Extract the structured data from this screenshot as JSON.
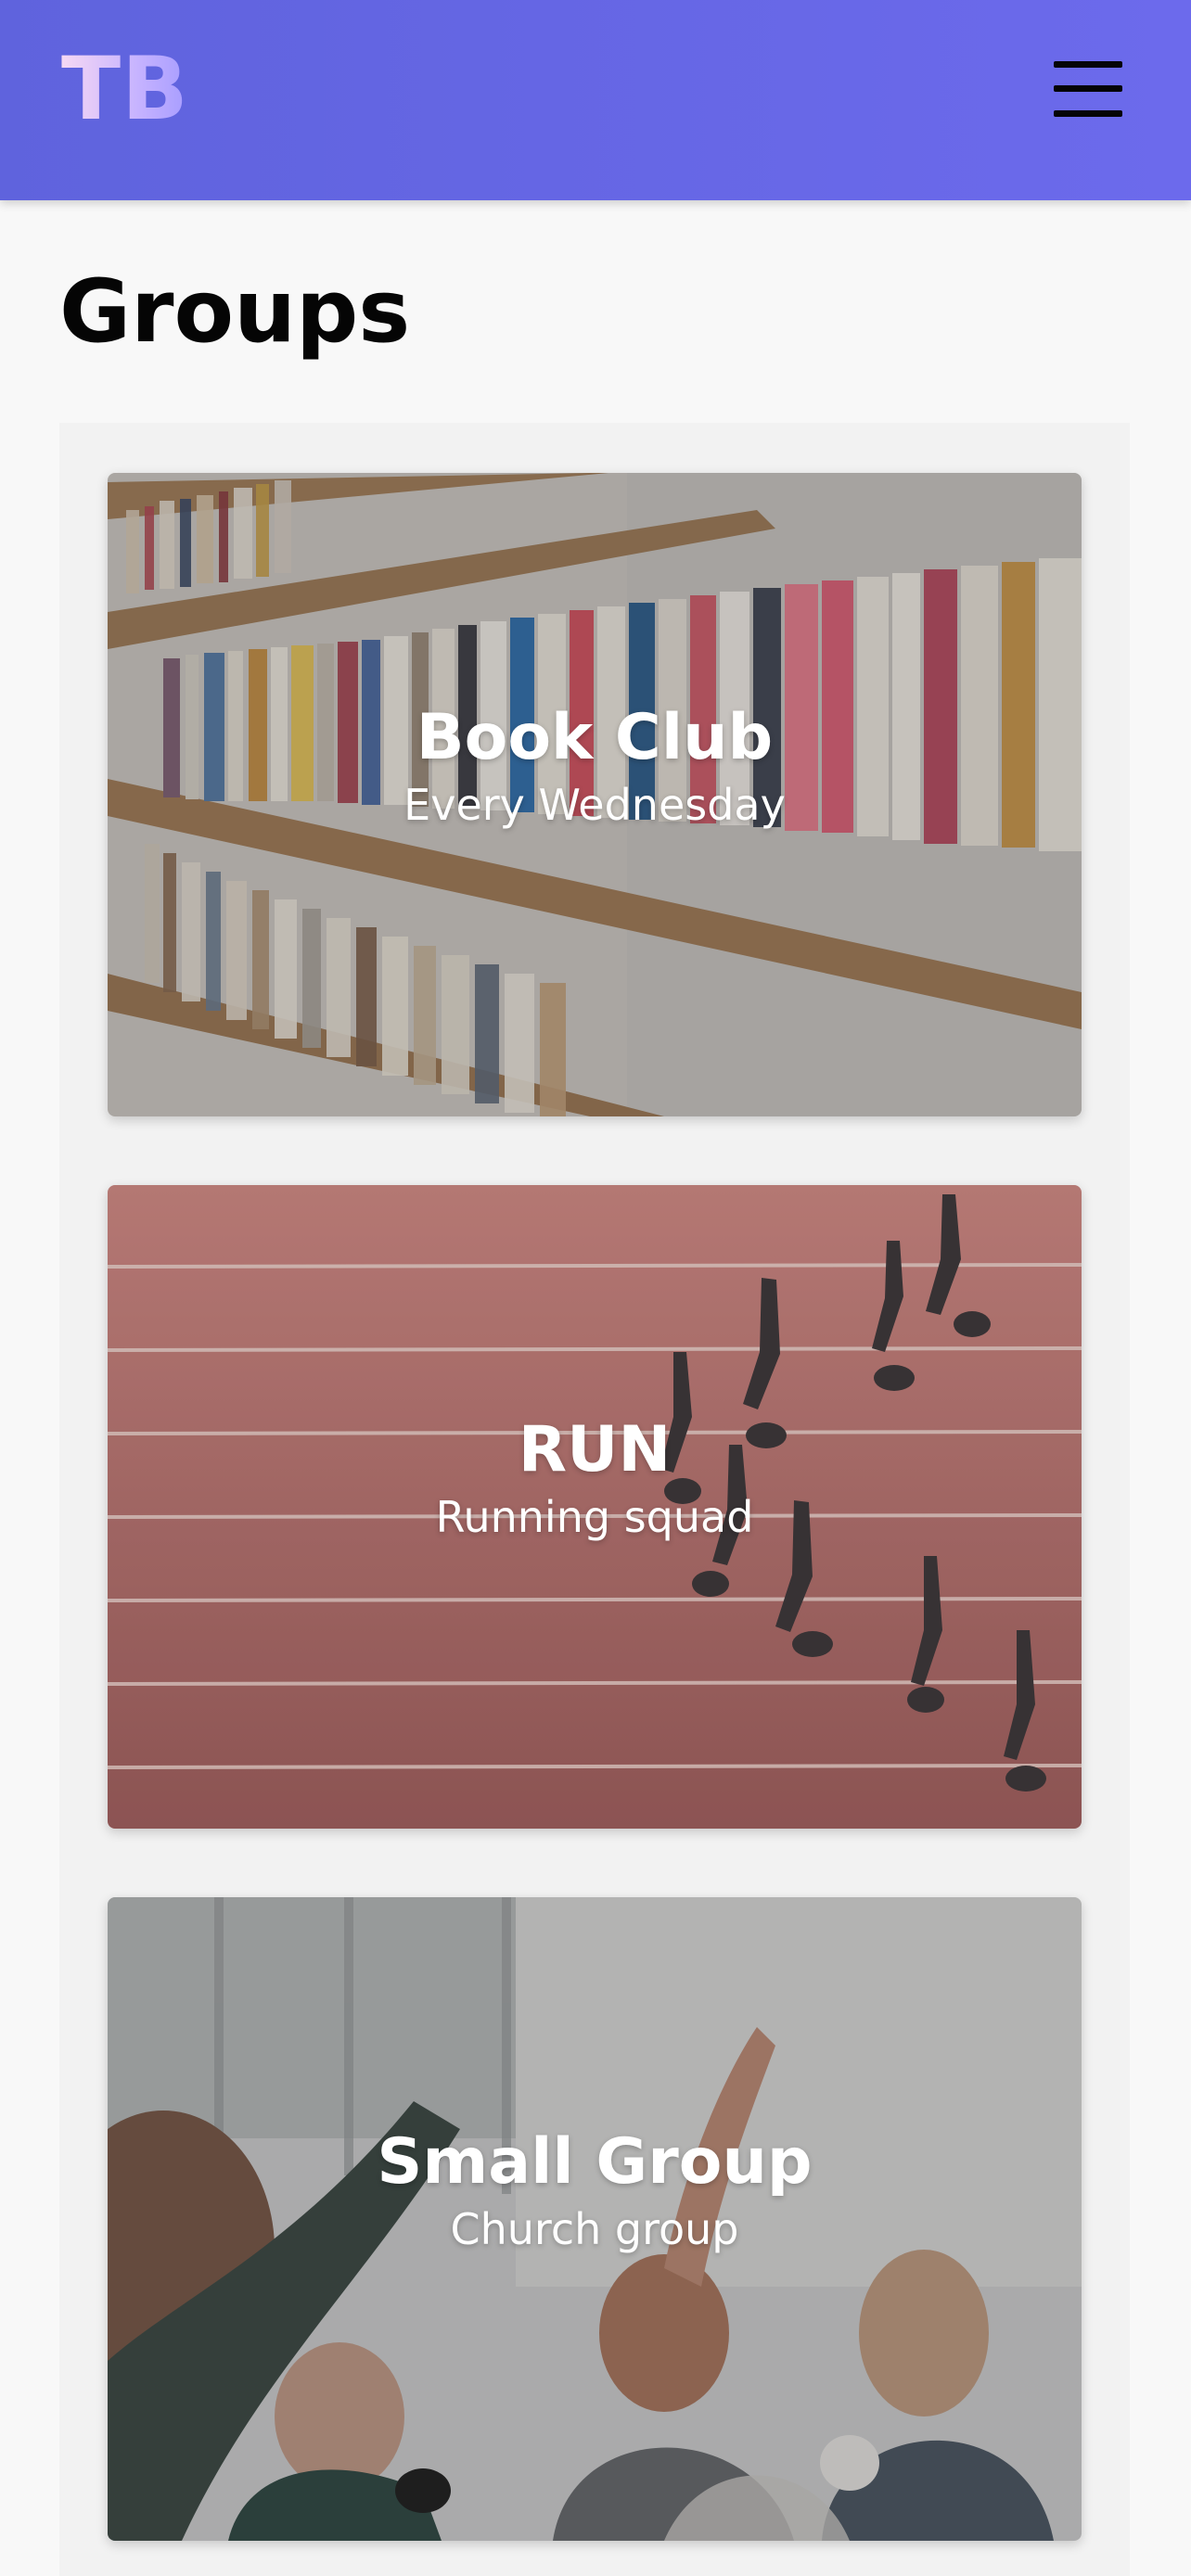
{
  "header": {
    "logo": "TB",
    "menu_icon": "hamburger-menu-icon"
  },
  "page": {
    "title": "Groups"
  },
  "groups": [
    {
      "title": "Book Club",
      "subtitle": "Every Wednesday",
      "image": "bookshelf-photo"
    },
    {
      "title": "RUN",
      "subtitle": "Running squad",
      "image": "running-track-photo"
    },
    {
      "title": "Small Group",
      "subtitle": "Church group",
      "image": "friends-high-five-photo"
    }
  ],
  "colors": {
    "header_start": "#5f63dd",
    "header_end": "#6c6aec",
    "background": "#f8f8f8",
    "panel": "#f2f2f2"
  }
}
